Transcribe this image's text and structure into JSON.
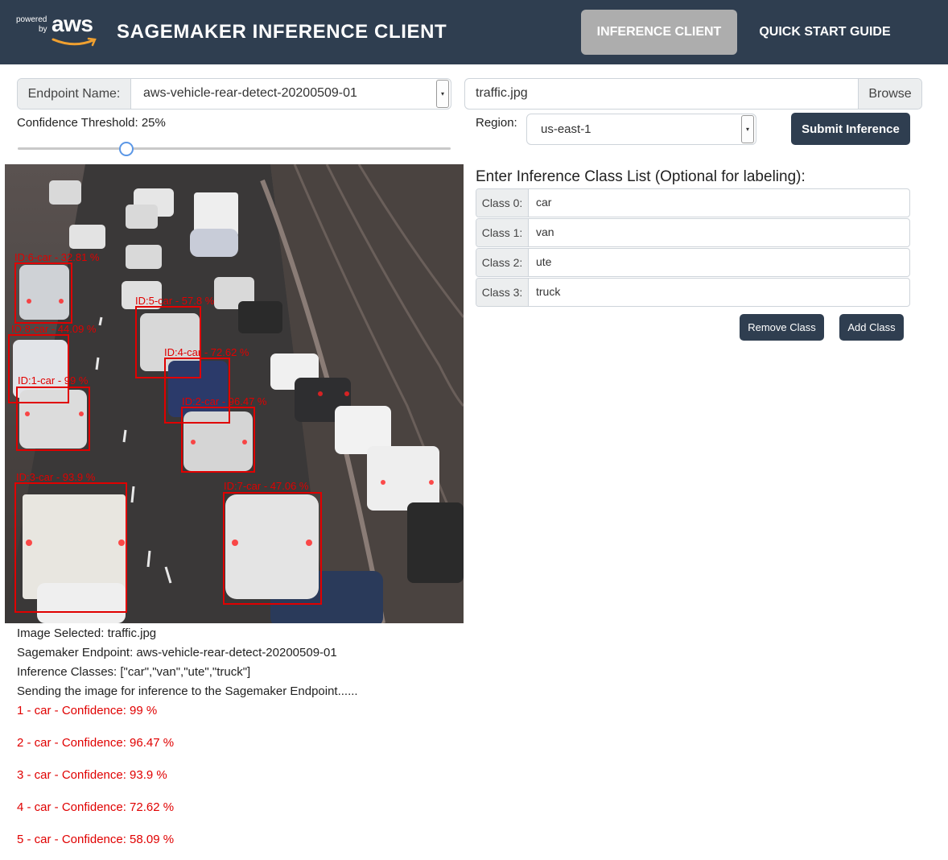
{
  "navbar": {
    "logo_powered": "powered",
    "logo_by": "by",
    "logo_aws": "aws",
    "title": "SAGEMAKER INFERENCE CLIENT",
    "tabs": [
      {
        "label": "INFERENCE CLIENT",
        "active": true
      },
      {
        "label": "QUICK START GUIDE",
        "active": false
      }
    ]
  },
  "endpoint": {
    "label": "Endpoint Name:",
    "value": "aws-vehicle-rear-detect-20200509-01"
  },
  "file": {
    "value": "traffic.jpg",
    "browse_label": "Browse"
  },
  "threshold": {
    "label": "Confidence Threshold: 25%",
    "value_percent": 25
  },
  "region": {
    "label": "Region:",
    "value": "us-east-1"
  },
  "submit_label": "Submit Inference",
  "classes": {
    "heading": "Enter Inference Class List (Optional for labeling):",
    "items": [
      {
        "label": "Class 0:",
        "value": "car"
      },
      {
        "label": "Class 1:",
        "value": "van"
      },
      {
        "label": "Class 2:",
        "value": "ute"
      },
      {
        "label": "Class 3:",
        "value": "truck"
      }
    ],
    "remove_label": "Remove Class",
    "add_label": "Add Class"
  },
  "detections": [
    {
      "label": "ID:6-car - 32.81 %"
    },
    {
      "label": "ID:5-car - 57.8 %"
    },
    {
      "label": "ID:8-car - 44.09 %"
    },
    {
      "label": "ID:4-car - 72.62 %"
    },
    {
      "label": "ID:1-car - 99 %"
    },
    {
      "label": "ID:2-car - 96.47 %"
    },
    {
      "label": "ID:3-car - 93.9 %"
    },
    {
      "label": "ID:7-car - 47.06 %"
    }
  ],
  "log": {
    "image_selected": "Image Selected: traffic.jpg",
    "endpoint": "Sagemaker Endpoint: aws-vehicle-rear-detect-20200509-01",
    "classes": "Inference Classes: [\"car\",\"van\",\"ute\",\"truck\"]",
    "sending": "Sending the image for inference to the Sagemaker Endpoint......",
    "results": [
      "1 - car - Confidence: 99 %",
      "2 - car - Confidence: 96.47 %",
      "3 - car - Confidence: 93.9 %",
      "4 - car - Confidence: 72.62 %",
      "5 - car - Confidence: 58.09 %"
    ]
  }
}
